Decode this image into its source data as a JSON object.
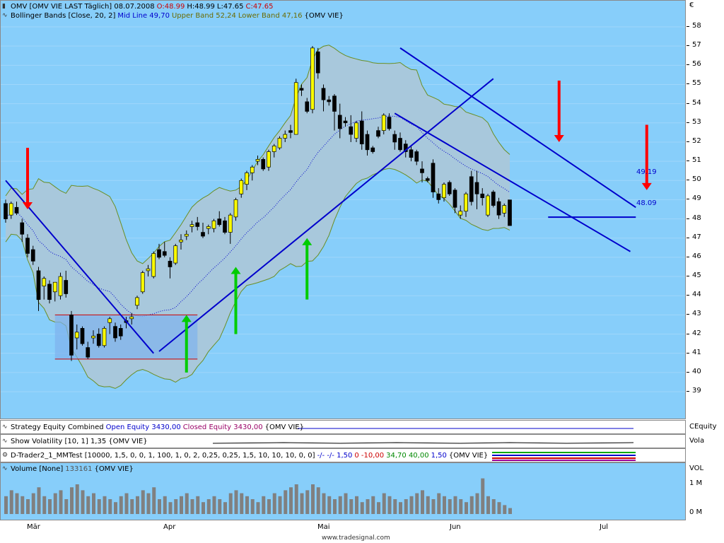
{
  "header": {
    "symbol": "OMV [OMV VIE LAST Täglich] 08.07.2008",
    "o": "O:48.99",
    "h": "H:48.99",
    "l": "L:47.65",
    "c": "C:47.65"
  },
  "bollinger_legend": {
    "name": "Bollinger Bands [Close, 20, 2]",
    "mid": "Mid Line 49,70",
    "upper": "Upper Band 52,24",
    "lower": "Lower Band 47,16",
    "symbol": "{OMV VIE}"
  },
  "currency": "€",
  "last_labels": {
    "upper": "49.19",
    "lower": "48.09"
  },
  "indicators": {
    "equity": {
      "name": "Strategy Equity Combined",
      "open": "Open Equity 3430,00",
      "closed": "Closed Equity 3430,00",
      "symbol": "{OMV VIE}",
      "axis": "CEquity"
    },
    "vola": {
      "name": "Show Volatility [10, 1] 1,35",
      "symbol": "{OMV VIE}",
      "axis": "Vola"
    },
    "dtrader": {
      "name": "D-Trader2_1_MMTest [10000, 1,5, 0, 0, 1, 100, 1, 0, 2, 0,25, 0,25, 1,5, 10, 10, 10, 0, 0]",
      "v1": "-/- -/- 1,50",
      "v2": "0 -10,00",
      "v3": "34,70 40,00",
      "v4": "1,50",
      "symbol": "{OMV VIE}"
    },
    "volume": {
      "name": "Volume [None]",
      "value": "133161",
      "symbol": "{OMV VIE}",
      "axis": "VOL",
      "ticks": [
        "1 M",
        "0 M"
      ]
    }
  },
  "footer": "www.tradesignal.com",
  "colors": {
    "bg": "#87cefa",
    "band": "#a8c8dc",
    "bull": "#ffff00",
    "bear": "#000000",
    "trend": "#0000cc",
    "red_arrow": "#ff0000",
    "green_arrow": "#00cc00"
  },
  "chart_data": {
    "type": "candlestick",
    "title": "OMV [OMV VIE LAST Täglich] 08.07.2008",
    "x_months": [
      "Mär",
      "Apr",
      "Mai",
      "Jun",
      "Jul"
    ],
    "y_ticks": [
      39,
      40,
      41,
      42,
      43,
      44,
      45,
      46,
      47,
      48,
      49,
      50,
      51,
      52,
      53,
      54,
      55,
      56,
      57,
      58
    ],
    "ylim": [
      38.5,
      58.5
    ],
    "candles": [
      [
        48.8,
        49.0,
        47.8,
        48.0
      ],
      [
        48.2,
        48.9,
        48.0,
        48.8
      ],
      [
        48.6,
        48.9,
        48.2,
        48.3
      ],
      [
        47.8,
        48.0,
        46.8,
        47.2
      ],
      [
        47.0,
        47.2,
        46.0,
        46.2
      ],
      [
        46.4,
        46.6,
        45.6,
        45.8
      ],
      [
        45.3,
        45.5,
        43.2,
        43.8
      ],
      [
        44.5,
        45.0,
        43.8,
        44.9
      ],
      [
        44.6,
        44.8,
        43.6,
        43.8
      ],
      [
        44.2,
        44.7,
        43.7,
        44.7
      ],
      [
        44.0,
        45.2,
        43.8,
        45.0
      ],
      [
        44.8,
        45.3,
        43.9,
        44.1
      ],
      [
        43.0,
        43.2,
        40.6,
        40.9
      ],
      [
        41.8,
        42.5,
        41.2,
        42.1
      ],
      [
        42.3,
        42.4,
        41.4,
        41.5
      ],
      [
        41.3,
        41.6,
        40.7,
        40.8
      ],
      [
        41.8,
        42.2,
        41.5,
        41.9
      ],
      [
        42.0,
        42.3,
        41.3,
        41.4
      ],
      [
        41.4,
        42.4,
        41.3,
        42.3
      ],
      [
        42.6,
        42.9,
        42.0,
        42.8
      ],
      [
        42.4,
        42.6,
        41.6,
        41.8
      ],
      [
        42.3,
        42.5,
        41.7,
        41.9
      ],
      [
        42.7,
        42.9,
        42.3,
        42.6
      ],
      [
        42.8,
        43.1,
        42.5,
        42.9
      ],
      [
        43.5,
        44.0,
        43.3,
        43.9
      ],
      [
        44.2,
        45.3,
        44.1,
        45.2
      ],
      [
        45.3,
        45.6,
        45.0,
        45.4
      ],
      [
        45.0,
        46.3,
        44.9,
        46.2
      ],
      [
        46.4,
        46.7,
        45.9,
        46.0
      ],
      [
        46.3,
        46.8,
        46.0,
        46.1
      ],
      [
        45.8,
        46.0,
        44.9,
        45.5
      ],
      [
        45.7,
        46.7,
        45.6,
        46.6
      ],
      [
        46.8,
        47.2,
        46.4,
        46.9
      ],
      [
        47.1,
        47.4,
        46.9,
        47.2
      ],
      [
        47.6,
        47.9,
        47.3,
        47.7
      ],
      [
        47.8,
        48.1,
        47.4,
        47.6
      ],
      [
        47.3,
        47.8,
        47.0,
        47.1
      ],
      [
        47.5,
        47.7,
        47.2,
        47.6
      ],
      [
        47.5,
        48.0,
        47.3,
        47.9
      ],
      [
        48.0,
        48.4,
        47.6,
        47.7
      ],
      [
        47.9,
        48.1,
        47.2,
        47.3
      ],
      [
        47.3,
        48.3,
        46.7,
        48.2
      ],
      [
        48.1,
        49.1,
        47.9,
        49.0
      ],
      [
        49.3,
        50.1,
        49.1,
        50.0
      ],
      [
        49.8,
        50.5,
        49.5,
        50.4
      ],
      [
        50.4,
        50.8,
        50.0,
        50.7
      ],
      [
        51.0,
        51.3,
        50.8,
        51.1
      ],
      [
        51.1,
        51.2,
        50.5,
        50.6
      ],
      [
        50.7,
        51.6,
        50.5,
        51.5
      ],
      [
        51.5,
        51.9,
        51.2,
        51.8
      ],
      [
        51.7,
        52.3,
        51.6,
        52.2
      ],
      [
        52.2,
        52.6,
        52.0,
        52.4
      ],
      [
        52.6,
        52.9,
        52.2,
        52.5
      ],
      [
        52.4,
        55.3,
        52.4,
        55.1
      ],
      [
        54.8,
        55.0,
        54.4,
        54.7
      ],
      [
        54.1,
        54.3,
        53.5,
        53.6
      ],
      [
        53.7,
        57.0,
        53.5,
        56.9
      ],
      [
        56.7,
        56.9,
        55.3,
        55.6
      ],
      [
        54.8,
        55.0,
        53.6,
        54.2
      ],
      [
        54.2,
        54.4,
        53.9,
        54.1
      ],
      [
        54.4,
        54.5,
        52.6,
        53.6
      ],
      [
        53.4,
        54.0,
        52.2,
        52.7
      ],
      [
        53.1,
        53.3,
        52.8,
        53.0
      ],
      [
        52.8,
        53.4,
        52.0,
        52.4
      ],
      [
        52.2,
        53.1,
        52.0,
        53.0
      ],
      [
        53.1,
        53.6,
        51.6,
        51.9
      ],
      [
        52.4,
        52.6,
        51.3,
        51.6
      ],
      [
        51.7,
        51.8,
        51.4,
        51.5
      ],
      [
        52.6,
        52.8,
        52.2,
        52.3
      ],
      [
        52.6,
        53.5,
        52.4,
        53.4
      ],
      [
        53.3,
        53.5,
        52.6,
        52.7
      ],
      [
        52.4,
        52.6,
        51.6,
        52.0
      ],
      [
        52.2,
        52.5,
        51.5,
        51.6
      ],
      [
        51.9,
        52.1,
        51.2,
        51.5
      ],
      [
        51.6,
        51.8,
        51.0,
        51.2
      ],
      [
        51.5,
        51.6,
        50.8,
        51.0
      ],
      [
        50.6,
        51.0,
        49.9,
        50.4
      ],
      [
        50.1,
        50.2,
        49.9,
        50.0
      ],
      [
        50.9,
        51.1,
        49.1,
        49.4
      ],
      [
        49.3,
        49.6,
        48.8,
        49.0
      ],
      [
        49.1,
        49.9,
        48.9,
        49.8
      ],
      [
        49.9,
        50.0,
        49.2,
        49.3
      ],
      [
        49.5,
        49.6,
        48.3,
        48.6
      ],
      [
        48.2,
        48.7,
        48.0,
        48.4
      ],
      [
        48.4,
        49.4,
        48.1,
        49.3
      ],
      [
        50.2,
        50.5,
        48.7,
        48.9
      ],
      [
        49.9,
        50.5,
        48.5,
        49.3
      ],
      [
        49.3,
        49.6,
        48.7,
        49.1
      ],
      [
        48.2,
        49.3,
        48.1,
        49.2
      ],
      [
        49.4,
        49.5,
        48.6,
        48.7
      ],
      [
        48.9,
        49.1,
        48.0,
        48.2
      ],
      [
        48.3,
        48.8,
        48.1,
        48.7
      ],
      [
        48.99,
        48.99,
        47.65,
        47.65
      ]
    ],
    "volume": [
      0.6,
      0.8,
      0.7,
      0.6,
      0.5,
      0.7,
      0.9,
      0.6,
      0.5,
      0.7,
      0.8,
      0.5,
      0.9,
      1.0,
      0.8,
      0.6,
      0.7,
      0.5,
      0.6,
      0.5,
      0.4,
      0.6,
      0.7,
      0.5,
      0.6,
      0.8,
      0.7,
      0.9,
      0.5,
      0.6,
      0.4,
      0.5,
      0.6,
      0.7,
      0.5,
      0.6,
      0.4,
      0.5,
      0.6,
      0.5,
      0.4,
      0.7,
      0.8,
      0.7,
      0.6,
      0.5,
      0.4,
      0.6,
      0.5,
      0.7,
      0.6,
      0.8,
      0.9,
      1.0,
      0.7,
      0.8,
      1.0,
      0.9,
      0.7,
      0.6,
      0.5,
      0.6,
      0.7,
      0.5,
      0.6,
      0.4,
      0.5,
      0.6,
      0.4,
      0.7,
      0.6,
      0.5,
      0.4,
      0.5,
      0.6,
      0.7,
      0.8,
      0.6,
      0.5,
      0.7,
      0.6,
      0.5,
      0.6,
      0.5,
      0.4,
      0.6,
      0.7,
      1.2,
      0.6,
      0.5,
      0.4,
      0.3,
      0.2
    ],
    "trendlines": [
      {
        "from": [
          0,
          50.0
        ],
        "to": [
          27,
          41.0
        ]
      },
      {
        "from": [
          28,
          41.1
        ],
        "to": [
          89,
          55.3
        ]
      },
      {
        "from": [
          72,
          56.9
        ],
        "to": [
          115,
          48.6
        ]
      },
      {
        "from": [
          71,
          53.5
        ],
        "to": [
          114,
          46.3
        ]
      },
      {
        "from": [
          99,
          48.09
        ],
        "to": [
          115,
          48.09
        ]
      }
    ],
    "rectangle": {
      "x0": 9,
      "x1": 35,
      "y0": 40.7,
      "y1": 43.0
    },
    "red_arrows": [
      {
        "i": 4,
        "from": 51.7,
        "to": 48.5
      },
      {
        "i": 101,
        "from": 55.2,
        "to": 52.0
      },
      {
        "i": 117,
        "from": 52.9,
        "to": 49.5
      }
    ],
    "green_arrows": [
      {
        "i": 33,
        "from": 40.0,
        "to": 43.0
      },
      {
        "i": 42,
        "from": 42.0,
        "to": 45.5
      },
      {
        "i": 55,
        "from": 43.8,
        "to": 47.0
      }
    ]
  }
}
